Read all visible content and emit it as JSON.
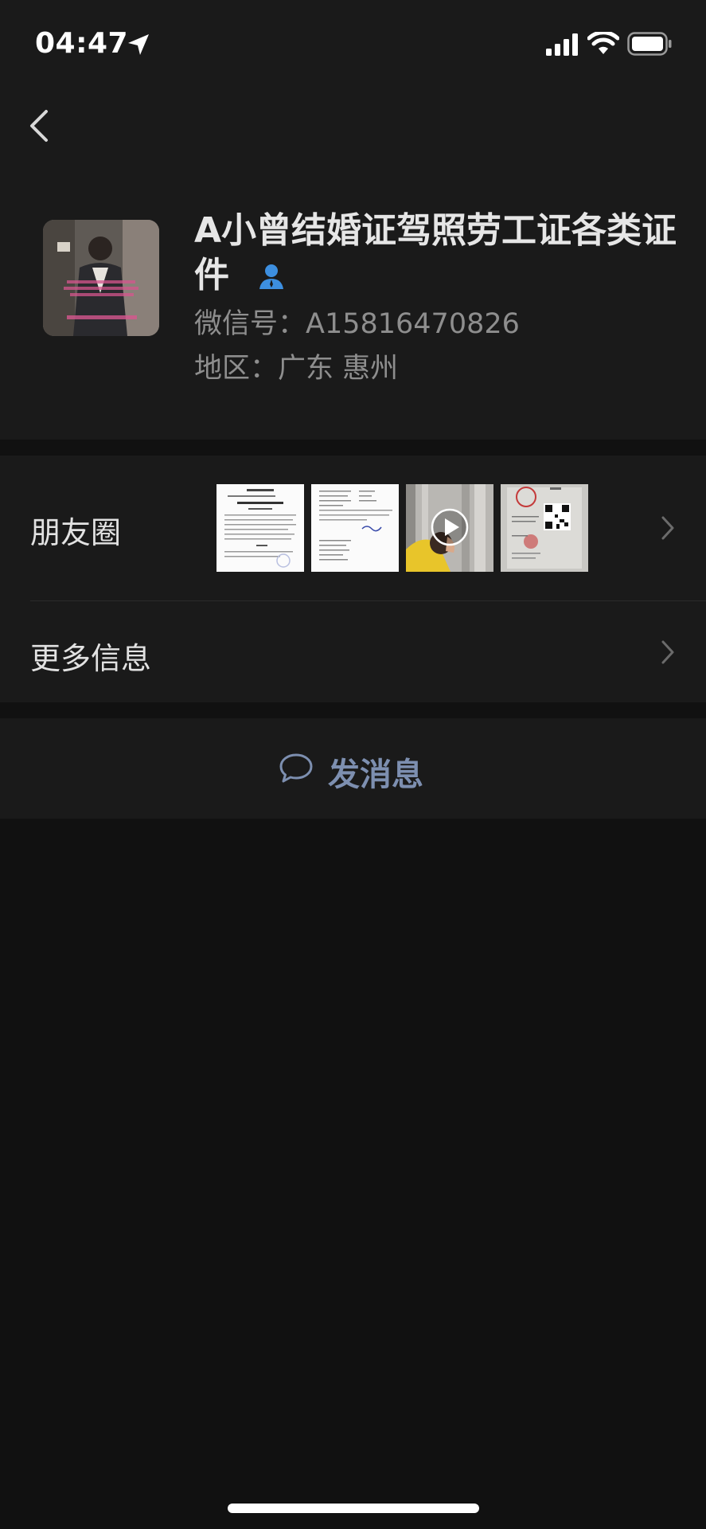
{
  "status_bar": {
    "time": "04:47",
    "icons": [
      "location-arrow-icon",
      "cellular-signal-icon",
      "wifi-icon",
      "battery-icon"
    ]
  },
  "profile": {
    "name": "A小曾结婚证驾照劳工证各类证件",
    "name_badge_icon": "user-icon",
    "wechat_id": "微信号：A15816470826",
    "region": "地区：广东 惠州"
  },
  "rows": {
    "moments_label": "朋友圈",
    "moments_thumbnails": [
      "document",
      "document",
      "video",
      "certificate"
    ],
    "more_info_label": "更多信息"
  },
  "actions": {
    "send_message_label": "发消息",
    "send_message_icon": "chat-bubble-icon"
  },
  "colors": {
    "background": "#111111",
    "panel": "#1a1a1a",
    "accent_link": "#7d8fb0",
    "badge_blue": "#3d8fe0"
  }
}
